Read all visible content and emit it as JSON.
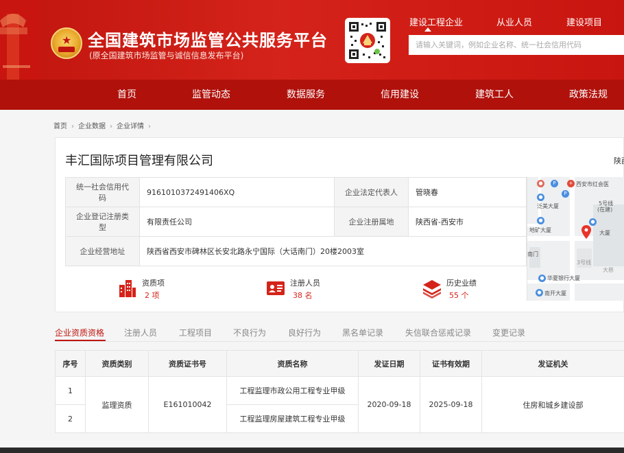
{
  "header": {
    "title": "全国建筑市场监管公共服务平台",
    "subtitle": "(原全国建筑市场监管与诚信信息发布平台)",
    "top_links": [
      "建设工程企业",
      "从业人员",
      "建设项目"
    ],
    "search_placeholder": "请输入关键词，例如企业名称、统一社会信用代码",
    "nav": [
      "首页",
      "监管动态",
      "数据服务",
      "信用建设",
      "建筑工人",
      "政策法规"
    ]
  },
  "breadcrumb": [
    "首页",
    "企业数据",
    "企业详情"
  ],
  "company": {
    "name": "丰汇国际项目管理有限公司",
    "right_text": "陕西",
    "credit_code_label": "统一社会信用代码",
    "credit_code": "9161010372491406XQ",
    "legal_rep_label": "企业法定代表人",
    "legal_rep": "管晓春",
    "reg_type_label": "企业登记注册类型",
    "reg_type": "有限责任公司",
    "location_label": "企业注册属地",
    "location": "陕西省-西安市",
    "address_label": "企业经营地址",
    "address": "陕西省西安市碑林区长安北路永宁国际（大话南门）20楼2003室"
  },
  "stats": [
    {
      "label": "资质项",
      "value": "2 项"
    },
    {
      "label": "注册人员",
      "value": "38 名"
    },
    {
      "label": "历史业绩",
      "value": "55 个"
    }
  ],
  "map": {
    "labels": [
      "西安市红会医",
      "泛美大厦",
      "5号线",
      "(在建)",
      "地矿大厦",
      "大厦",
      "南门",
      "3号线",
      "华夏银行大厦",
      "南开大厦",
      "大慈"
    ]
  },
  "tabs": [
    "企业资质资格",
    "注册人员",
    "工程项目",
    "不良行为",
    "良好行为",
    "黑名单记录",
    "失信联合惩戒记录",
    "变更记录"
  ],
  "qual_table": {
    "headers": [
      "序号",
      "资质类别",
      "资质证书号",
      "资质名称",
      "发证日期",
      "证书有效期",
      "发证机关"
    ],
    "rows": [
      {
        "no": "1",
        "name": "工程监理市政公用工程专业甲级"
      },
      {
        "no": "2",
        "name": "工程监理房屋建筑工程专业甲级"
      }
    ],
    "category": "监理资质",
    "cert_no": "E161010042",
    "issue_date": "2020-09-18",
    "valid_until": "2025-09-18",
    "authority": "住房和城乡建设部"
  },
  "colors": {
    "brand_red": "#c0150e",
    "nav_red": "#b0110b",
    "accent_value": "#d4241a"
  }
}
